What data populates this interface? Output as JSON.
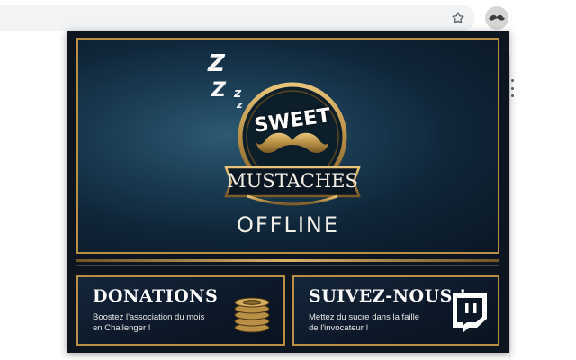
{
  "browser": {
    "star_icon": "star-icon",
    "extension_icon": "mustache-icon",
    "menu_icon": "kebab-menu-icon"
  },
  "hero": {
    "brand_top": "SWEET",
    "brand_bottom": "MUSTACHES",
    "status": "OFFLINE",
    "sleep_letters": [
      "Z",
      "Z",
      "z",
      "z"
    ],
    "accent_color": "#b88f45"
  },
  "cards": {
    "donations": {
      "title": "DONATIONS",
      "text_line1": "Boostez l'association du mois",
      "text_line2": "en Challenger !",
      "icon": "coins-icon"
    },
    "follow": {
      "title": "SUIVEZ-NOUS !",
      "text_line1": "Mettez du sucre dans la faille",
      "text_line2": "de l'invocateur !",
      "icon": "twitch-icon"
    }
  }
}
